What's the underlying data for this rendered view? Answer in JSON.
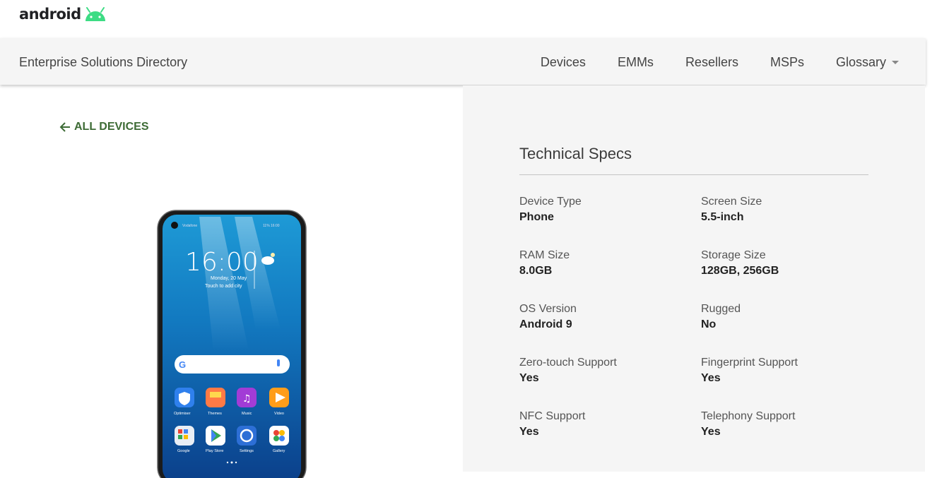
{
  "logo": {
    "text": "android",
    "icon": "android-robot-icon",
    "color": "#3ddc84"
  },
  "navbar": {
    "brand": "Enterprise Solutions Directory",
    "items": [
      {
        "label": "Devices"
      },
      {
        "label": "EMMs"
      },
      {
        "label": "Resellers"
      },
      {
        "label": "MSPs"
      },
      {
        "label": "Glossary",
        "dropdown": true
      }
    ]
  },
  "back_link": {
    "label": "ALL DEVICES",
    "icon": "arrow-left-icon",
    "color": "#3d6b35"
  },
  "phone": {
    "clock": "16:00",
    "date": "Monday, 20 May",
    "city_hint": "Touch to add city",
    "apps_row1": [
      "Optimiser",
      "Themes",
      "Music",
      "Video"
    ],
    "apps_row2": [
      "Google",
      "Play Store",
      "Settings",
      "Gallery"
    ]
  },
  "specs": {
    "title": "Technical Specs",
    "items": [
      {
        "label": "Device Type",
        "value": "Phone"
      },
      {
        "label": "Screen Size",
        "value": "5.5-inch"
      },
      {
        "label": "RAM Size",
        "value": "8.0GB"
      },
      {
        "label": "Storage Size",
        "value": "128GB, 256GB"
      },
      {
        "label": "OS Version",
        "value": "Android 9"
      },
      {
        "label": "Rugged",
        "value": "No"
      },
      {
        "label": "Zero-touch Support",
        "value": "Yes"
      },
      {
        "label": "Fingerprint Support",
        "value": "Yes"
      },
      {
        "label": "NFC Support",
        "value": "Yes"
      },
      {
        "label": "Telephony Support",
        "value": "Yes"
      }
    ]
  }
}
